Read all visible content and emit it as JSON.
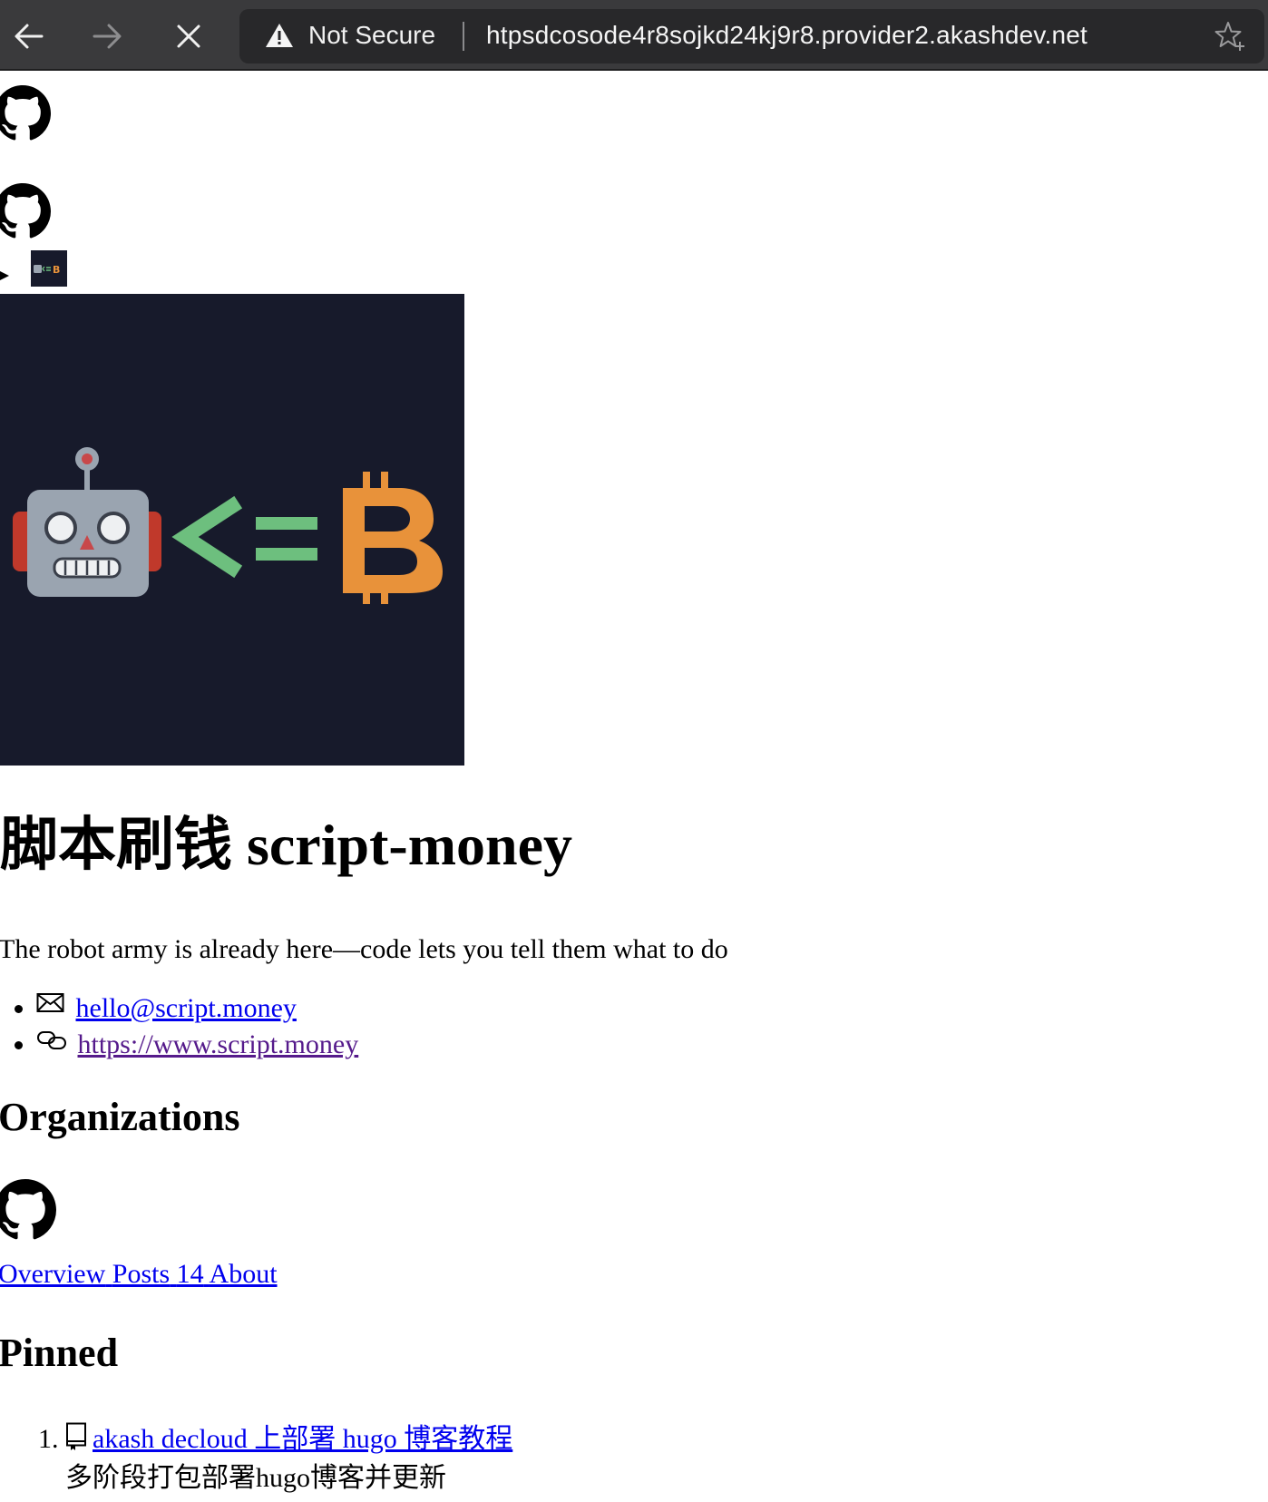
{
  "browser": {
    "security_label": "Not Secure",
    "url": "htpsdcosode4r8sojkd24kj9r8.provider2.akashdev.net",
    "icons": {
      "back": "arrow-left-icon",
      "forward": "arrow-right-icon",
      "stop": "close-icon",
      "warning": "warning-triangle-icon",
      "bookmark": "star-plus-icon"
    }
  },
  "avatar_logo": {
    "robot": "robot-face",
    "operator": "<=",
    "symbol": "bitcoin",
    "colors": {
      "background": "#171a2b",
      "operator": "#6dbf7e",
      "bitcoin": "#e8923a"
    }
  },
  "profile": {
    "title": "脚本刷钱 script-money",
    "tagline": "The robot army is already here—code lets you tell them what to do",
    "contacts": [
      {
        "icon": "mail-icon",
        "text": "hello@script.money"
      },
      {
        "icon": "link-icon",
        "text": "https://www.script.money"
      }
    ]
  },
  "organizations": {
    "heading": "Organizations"
  },
  "tabs": {
    "overview": "Overview",
    "posts": "Posts",
    "posts_count": "14",
    "about": "About"
  },
  "pinned": {
    "heading": "Pinned",
    "items": [
      {
        "icon": "repo-icon",
        "title": "akash decloud  上部署 hugo 博客教程",
        "description": "多阶段打包部署hugo博客并更新"
      }
    ]
  },
  "colors": {
    "link": "#0000ee",
    "link_visited": "#551a8b",
    "chrome_bg": "#3a3a3c",
    "omnibox_bg": "#28282a"
  }
}
